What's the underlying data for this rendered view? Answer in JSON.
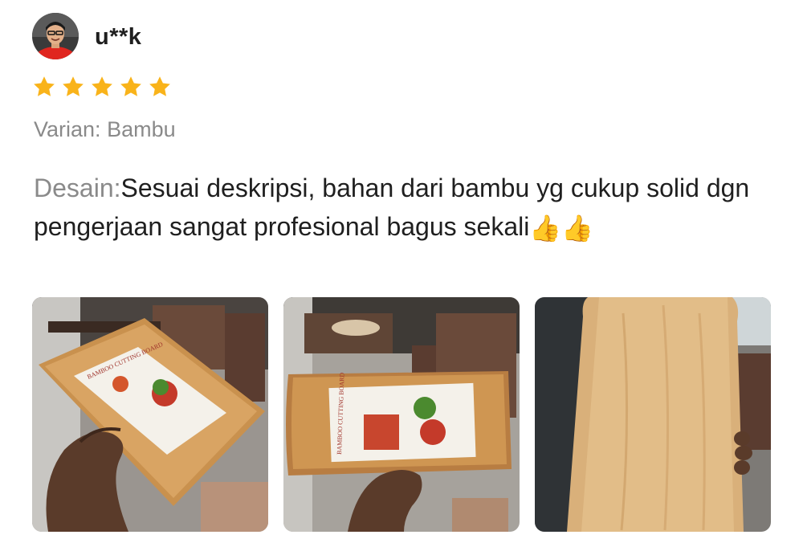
{
  "review": {
    "username": "u**k",
    "rating": 5,
    "rating_max": 5,
    "star_color": "#F9B31A",
    "variant_label": "Varian:",
    "variant_value": "Bambu",
    "text_label": "Desain:",
    "text_body": "Sesuai deskripsi, bahan dari bambu yg cukup solid dgn pengerjaan sangat profesional bagus sekali",
    "emoji_1": "👍",
    "emoji_2": "👍"
  },
  "photos": [
    {
      "icon": "cutting-board-photo",
      "board_label": "BAMBOO CUTTING BOARD"
    },
    {
      "icon": "cutting-board-photo",
      "board_label": "BAMBOO CUTTING BOARD"
    },
    {
      "icon": "cutting-board-back-photo",
      "board_label": ""
    }
  ]
}
